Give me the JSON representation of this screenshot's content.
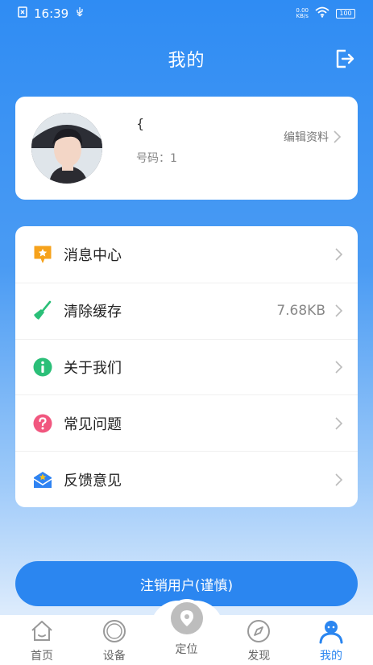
{
  "status_bar": {
    "time": "16:39",
    "network_rate_value": "0.00",
    "network_rate_unit": "KB/s",
    "battery": "100"
  },
  "header": {
    "title": "我的"
  },
  "profile": {
    "nickname": "{",
    "phone_label": "号码：1",
    "edit_label": "编辑资料"
  },
  "menu": {
    "items": [
      {
        "label": "消息中心",
        "value": "",
        "icon": "message-icon"
      },
      {
        "label": "清除缓存",
        "value": "7.68KB",
        "icon": "broom-icon"
      },
      {
        "label": "关于我们",
        "value": "",
        "icon": "info-icon"
      },
      {
        "label": "常见问题",
        "value": "",
        "icon": "question-icon"
      },
      {
        "label": "反馈意见",
        "value": "",
        "icon": "feedback-icon"
      }
    ]
  },
  "actions": {
    "deregister_label": "注销用户(谨慎)"
  },
  "tabbar": {
    "items": [
      {
        "label": "首页",
        "icon": "home-icon"
      },
      {
        "label": "设备",
        "icon": "device-icon"
      },
      {
        "label": "定位",
        "icon": "location-icon"
      },
      {
        "label": "发现",
        "icon": "compass-icon"
      },
      {
        "label": "我的",
        "icon": "user-icon"
      }
    ],
    "active_index": 4
  },
  "colors": {
    "accent": "#2b86f0",
    "icon_orange": "#f6a21b",
    "icon_green": "#2bbf78",
    "icon_pink": "#f1577f",
    "icon_blue": "#2f83f2"
  }
}
